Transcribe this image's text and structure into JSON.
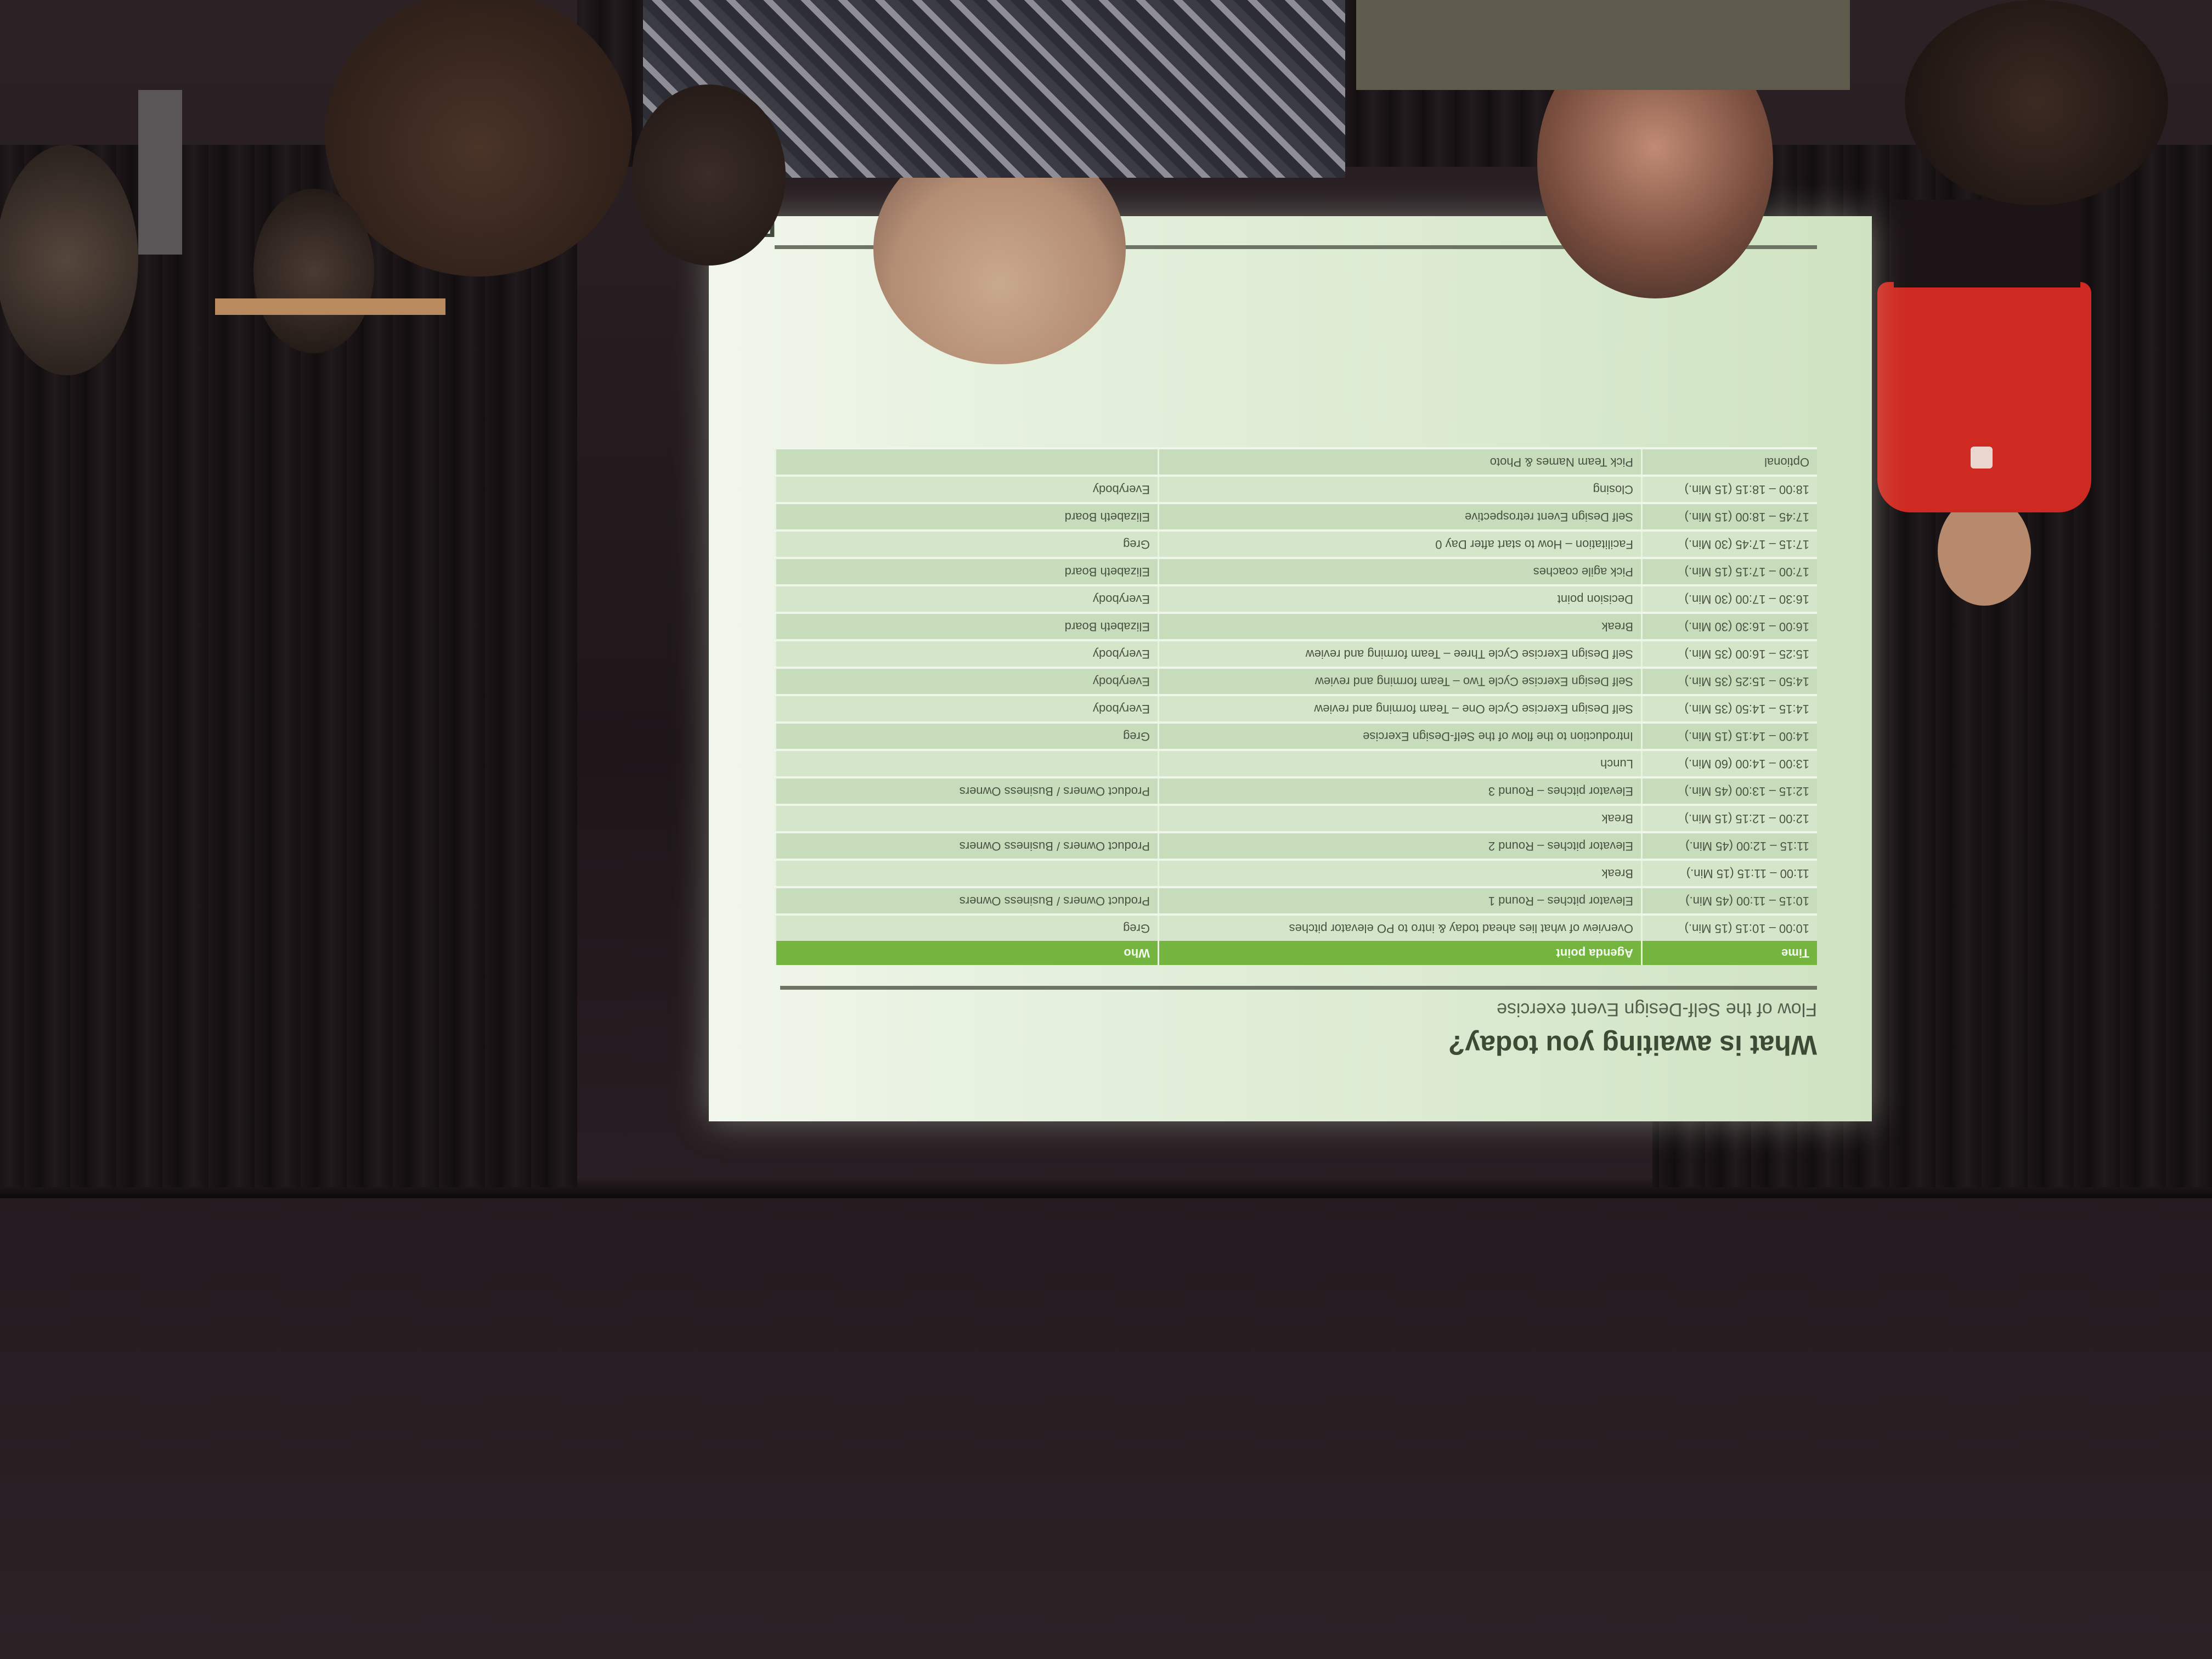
{
  "slide": {
    "title": "What is awaiting you today?",
    "subtitle": "Flow of the Self-Design Event exercise",
    "corner_letter": "F",
    "columns": [
      "Time",
      "Agenda point",
      "Who"
    ],
    "rows": [
      {
        "time": "10:00 – 10:15 (15 Min.)",
        "point": "Overview of what lies ahead today & intro to PO elevator pitches",
        "who": "Greg"
      },
      {
        "time": "10:15 – 11:00 (45 Min.)",
        "point": "Elevator pitches – Round 1",
        "who": "Product Owners / Business Owners"
      },
      {
        "time": "11:00 – 11:15 (15 Min.)",
        "point": "Break",
        "who": ""
      },
      {
        "time": "11:15 – 12:00 (45 Min.)",
        "point": "Elevator pitches – Round 2",
        "who": "Product Owners / Business Owners"
      },
      {
        "time": "12:00 – 12:15 (15 Min.)",
        "point": "Break",
        "who": ""
      },
      {
        "time": "12:15 – 13:00 (45 Min.)",
        "point": "Elevator pitches – Round 3",
        "who": "Product Owners / Business Owners"
      },
      {
        "time": "13:00 – 14:00 (60 Min.)",
        "point": "Lunch",
        "who": ""
      },
      {
        "time": "14:00 – 14:15 (15 Min.)",
        "point": "Introduction to the flow of the Self-Design Exercise",
        "who": "Greg"
      },
      {
        "time": "14:15 – 14:50 (35 Min.)",
        "point": "Self Design Exercise Cycle One – Team forming and review",
        "who": "Everybody"
      },
      {
        "time": "14:50 – 15:25 (35 Min.)",
        "point": "Self Design Exercise Cycle Two – Team forming and review",
        "who": "Everybody"
      },
      {
        "time": "15:25 – 16:00 (35 Min.)",
        "point": "Self Design Exercise Cycle Three – Team forming and review",
        "who": "Everybody"
      },
      {
        "time": "16:00 – 16:30 (30 Min.)",
        "point": "Break",
        "who": "Elizabeth Board"
      },
      {
        "time": "16:30 – 17:00 (30 Min.)",
        "point": "Decision point",
        "who": "Everybody"
      },
      {
        "time": "17:00 – 17:15 (15 Min.)",
        "point": "Pick agile coaches",
        "who": "Elizabeth Board"
      },
      {
        "time": "17:15 – 17:45 (30 Min.)",
        "point": "Facilitation – How to start after Day 0",
        "who": "Greg"
      },
      {
        "time": "17:45 – 18:00 (15 Min.)",
        "point": "Self Design Event retrospective",
        "who": "Elizabeth Board"
      },
      {
        "time": "18:00 – 18:15 (15 Min.)",
        "point": "Closing",
        "who": "Everybody"
      },
      {
        "time": "Optional",
        "point": "Pick Team Names & Photo",
        "who": ""
      }
    ]
  },
  "colors": {
    "header_green": "#73b53e",
    "screen_light": "#e6f1de",
    "curtain": "#1b1517",
    "shirt_red": "#d0231f"
  }
}
